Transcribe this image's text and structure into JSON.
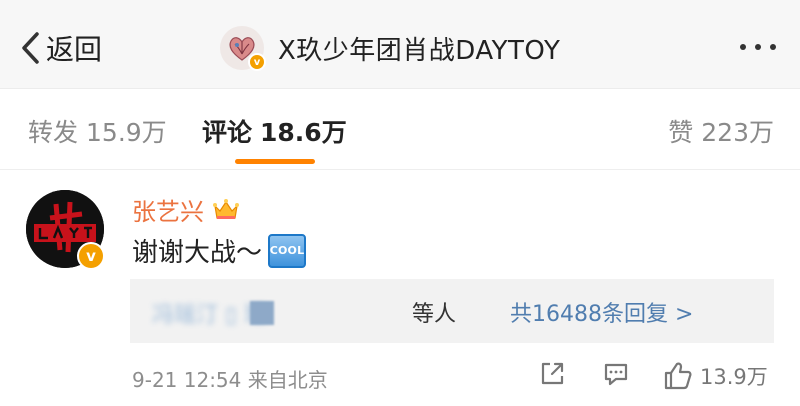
{
  "header": {
    "back_label": "返回",
    "title": "X玖少年团肖战DAYTOY",
    "verified_mark": "v"
  },
  "tabs": {
    "repost": {
      "label": "转发",
      "count": "15.9万"
    },
    "comment": {
      "label": "评论",
      "count": "18.6万"
    },
    "like": {
      "label": "赞",
      "count": "223万"
    }
  },
  "comment": {
    "username": "张艺兴",
    "verified_mark": "v",
    "text": "谢谢大战～",
    "emoji_text": "COOL",
    "replies": {
      "names_suffix": "等人",
      "blurred_names": "冯瑶汀 ▯ 理",
      "count_text": "共16488条回复 >"
    },
    "meta": "9-21 12:54  来自北京",
    "like_count": "13.9万"
  },
  "colors": {
    "accent": "#ff8200",
    "username": "#eb7340",
    "link": "#507daf",
    "verified": "#f4a000"
  },
  "icons": [
    "back-chevron-icon",
    "more-dots-icon",
    "crown-icon",
    "share-icon",
    "comment-icon",
    "like-thumb-icon"
  ]
}
